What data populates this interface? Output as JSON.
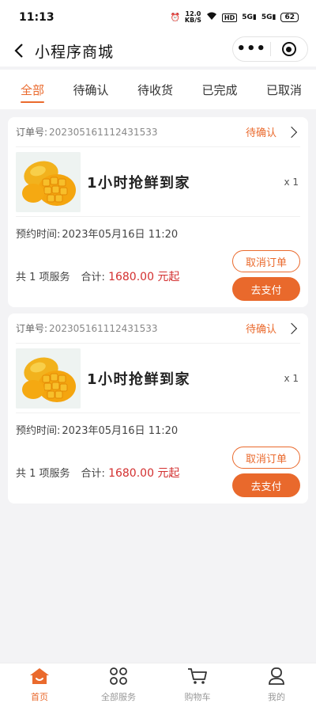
{
  "status_bar": {
    "time": "11:13",
    "net_speed_top": "12.0",
    "net_speed_bottom": "KB/S",
    "hd": "HD",
    "signal1": "5G",
    "signal2": "5G",
    "battery": "62"
  },
  "nav": {
    "title": "小程序商城"
  },
  "tabs": [
    {
      "label": "全部",
      "active": true
    },
    {
      "label": "待确认",
      "active": false
    },
    {
      "label": "待收货",
      "active": false
    },
    {
      "label": "已完成",
      "active": false
    },
    {
      "label": "已取消",
      "active": false
    }
  ],
  "orders": [
    {
      "order_no_label": "订单号:",
      "order_no": "202305161112431533",
      "status": "待确认",
      "product_name": "1小时抢鲜到家",
      "qty": "x 1",
      "booking_label": "预约时间:",
      "booking_time": "2023年05月16日 11:20",
      "service_count": "共 1 项服务",
      "total_label": "合计:",
      "total_price": "1680.00 元起",
      "cancel_label": "取消订单",
      "pay_label": "去支付"
    },
    {
      "order_no_label": "订单号:",
      "order_no": "202305161112431533",
      "status": "待确认",
      "product_name": "1小时抢鲜到家",
      "qty": "x 1",
      "booking_label": "预约时间:",
      "booking_time": "2023年05月16日 11:20",
      "service_count": "共 1 项服务",
      "total_label": "合计:",
      "total_price": "1680.00 元起",
      "cancel_label": "取消订单",
      "pay_label": "去支付"
    }
  ],
  "tabbar": [
    {
      "label": "首页",
      "icon": "home-icon",
      "active": true
    },
    {
      "label": "全部服务",
      "icon": "grid-icon",
      "active": false
    },
    {
      "label": "购物车",
      "icon": "cart-icon",
      "active": false
    },
    {
      "label": "我的",
      "icon": "user-icon",
      "active": false
    }
  ],
  "colors": {
    "accent": "#ea6a2d",
    "price": "#d32f2f",
    "background": "#f3f3f5"
  }
}
